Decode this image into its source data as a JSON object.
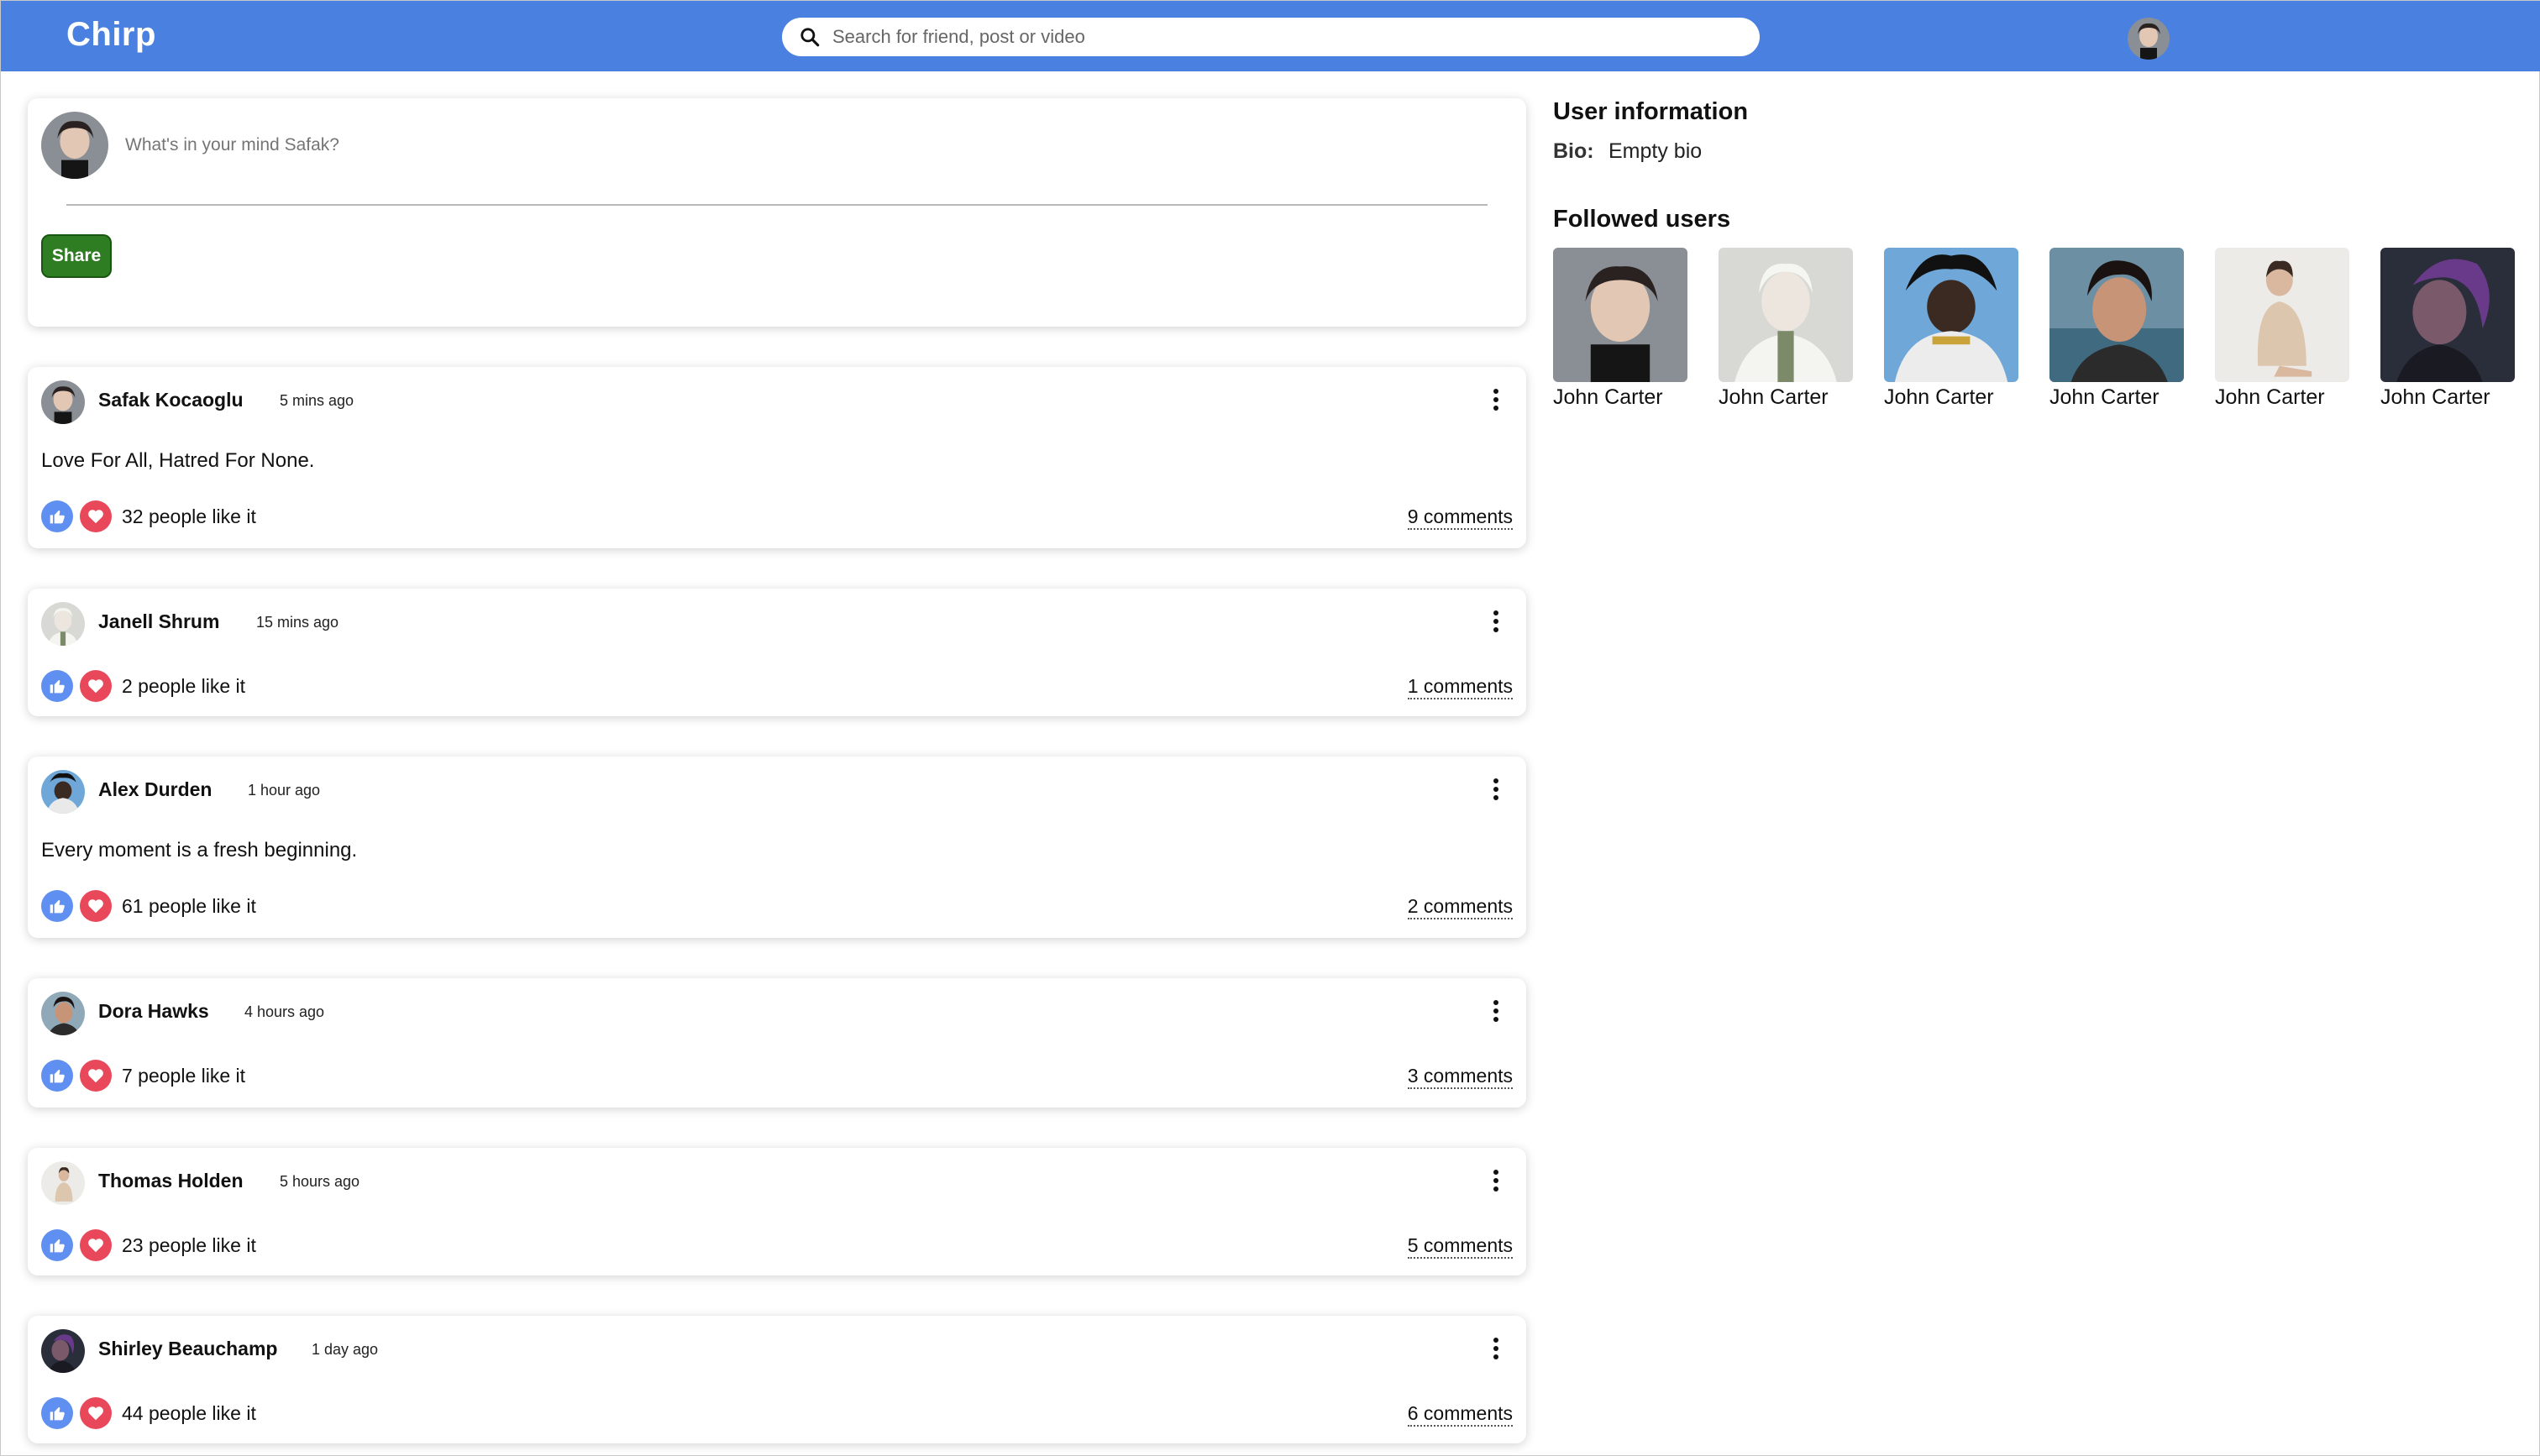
{
  "app": {
    "name": "Chirp"
  },
  "search": {
    "placeholder": "Search for friend, post or video"
  },
  "composer": {
    "placeholder": "What's in your mind Safak?",
    "share_label": "Share"
  },
  "posts": [
    {
      "author": "Safak Kocaoglu",
      "time": "5 mins ago",
      "text": "Love For All, Hatred For None.",
      "likes": "32 people like it",
      "comments": "9 comments"
    },
    {
      "author": "Janell Shrum",
      "time": "15 mins ago",
      "text": "",
      "likes": "2 people like it",
      "comments": "1 comments"
    },
    {
      "author": "Alex Durden",
      "time": "1 hour ago",
      "text": "Every moment is a fresh beginning.",
      "likes": "61 people like it",
      "comments": "2 comments"
    },
    {
      "author": "Dora Hawks",
      "time": "4 hours ago",
      "text": "",
      "likes": "7 people like it",
      "comments": "3 comments"
    },
    {
      "author": "Thomas Holden",
      "time": "5 hours ago",
      "text": "",
      "likes": "23 people like it",
      "comments": "5 comments"
    },
    {
      "author": "Shirley Beauchamp",
      "time": "1 day ago",
      "text": "",
      "likes": "44 people like it",
      "comments": "6 comments"
    }
  ],
  "sidebar": {
    "user_info_title": "User information",
    "bio_label": "Bio:",
    "bio_value": "Empty bio",
    "followed_title": "Followed users",
    "followed": [
      {
        "name": "John Carter"
      },
      {
        "name": "John Carter"
      },
      {
        "name": "John Carter"
      },
      {
        "name": "John Carter"
      },
      {
        "name": "John Carter"
      },
      {
        "name": "John Carter"
      }
    ]
  },
  "colors": {
    "topbar": "#4a80e0",
    "share": "#2f7d22",
    "like": "#5f8ff0",
    "love": "#e8485a"
  },
  "icons": {
    "search": "search-icon",
    "like": "thumbs-up-icon",
    "love": "heart-icon",
    "menu": "more-vertical-icon"
  }
}
